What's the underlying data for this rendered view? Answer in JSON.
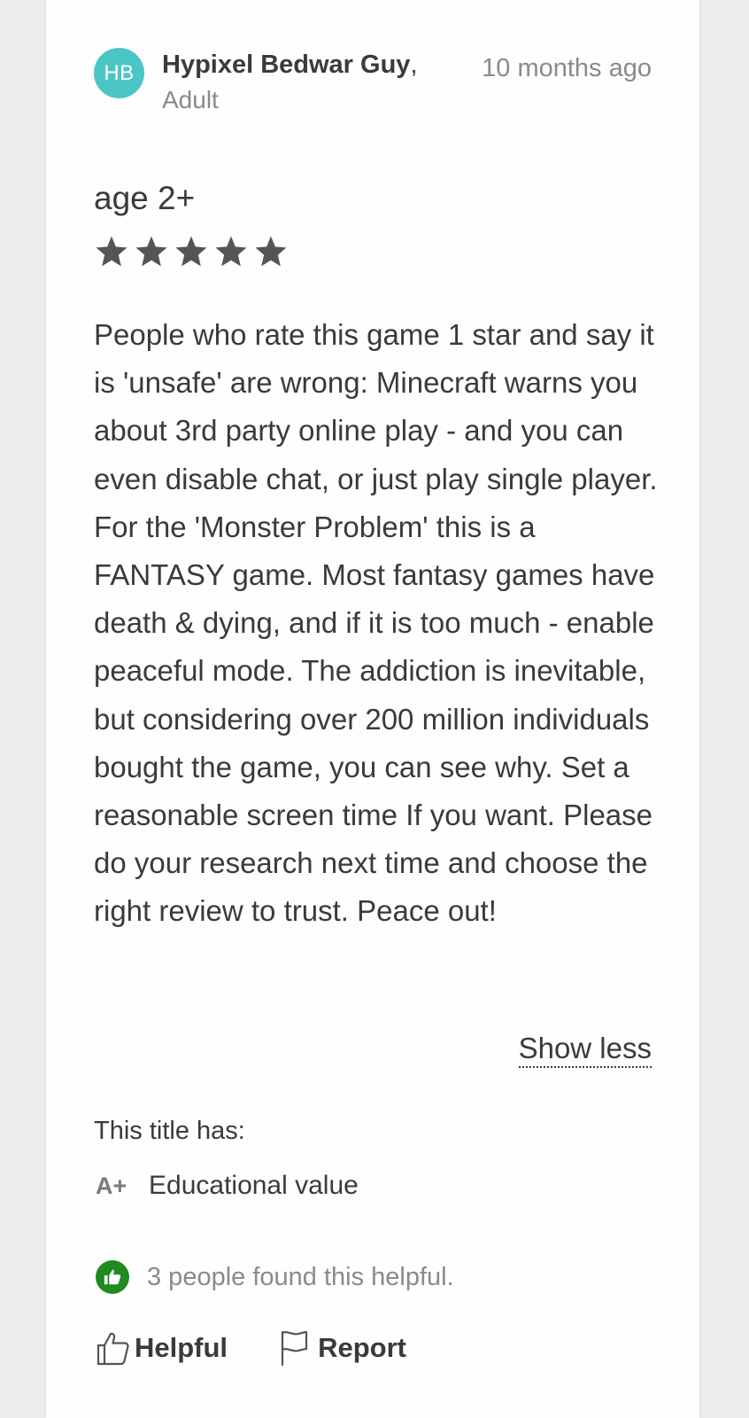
{
  "review": {
    "author_initials": "HB",
    "author_name": "Hypixel Bedwar Guy",
    "author_separator": ",",
    "author_role": "Adult",
    "timestamp": "10 months ago",
    "age_rating": "age 2+",
    "stars": 5,
    "stars_max": 5,
    "body": "People who rate this game 1 star and say it is 'unsafe' are wrong: Minecraft warns you about 3rd party online play - and you can even disable chat, or just play single player. For the 'Monster Problem' this is a FANTASY game. Most fantasy games have death & dying, and if it is too much - enable peaceful mode. The addiction is inevitable, but considering over 200 million individuals bought the game, you can see why. Set a reasonable screen time If you want. Please do your research next time and choose the right review to trust. Peace out!",
    "show_less_label": "Show less"
  },
  "attributes": {
    "heading": "This title has:",
    "items": [
      {
        "icon": "a-plus-icon",
        "icon_text": "A+",
        "label": "Educational value"
      }
    ]
  },
  "helpful_summary": {
    "icon": "thumbs-up-badge-icon",
    "text": "3 people found this helpful."
  },
  "actions": {
    "helpful_label": "Helpful",
    "report_label": "Report"
  },
  "colors": {
    "avatar": "#4cc5c7",
    "helpful_badge": "#1f8a1f",
    "star": "#555555"
  }
}
